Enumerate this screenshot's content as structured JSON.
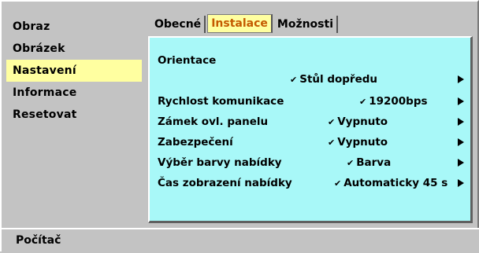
{
  "sidebar": {
    "items": [
      {
        "label": "Obraz"
      },
      {
        "label": "Obrázek"
      },
      {
        "label": "Nastavení"
      },
      {
        "label": "Informace"
      },
      {
        "label": "Resetovat"
      }
    ],
    "active_index": 2
  },
  "tabs": [
    {
      "label": "Obecné"
    },
    {
      "label": "Instalace"
    },
    {
      "label": "Možnosti"
    }
  ],
  "active_tab": "Instalace",
  "settings": {
    "orientation_label": "Orientace",
    "orientation_value": "Stůl dopředu",
    "rows": [
      {
        "label": "Rychlost komunikace",
        "value": "19200bps"
      },
      {
        "label": "Zámek ovl. panelu",
        "value": "Vypnuto"
      },
      {
        "label": "Zabezpečení",
        "value": "Vypnuto"
      },
      {
        "label": "Výběr barvy nabídky",
        "value": "Barva"
      },
      {
        "label": "Čas zobrazení nabídky",
        "value": "Automaticky 45 s"
      }
    ],
    "check_mark": "✔"
  },
  "status": {
    "label": "Počítač"
  },
  "colors": {
    "highlight": "#ffffa0",
    "panel": "#a8f8f8",
    "active_tab_text": "#c45a00",
    "chrome": "#c3c3c3"
  }
}
